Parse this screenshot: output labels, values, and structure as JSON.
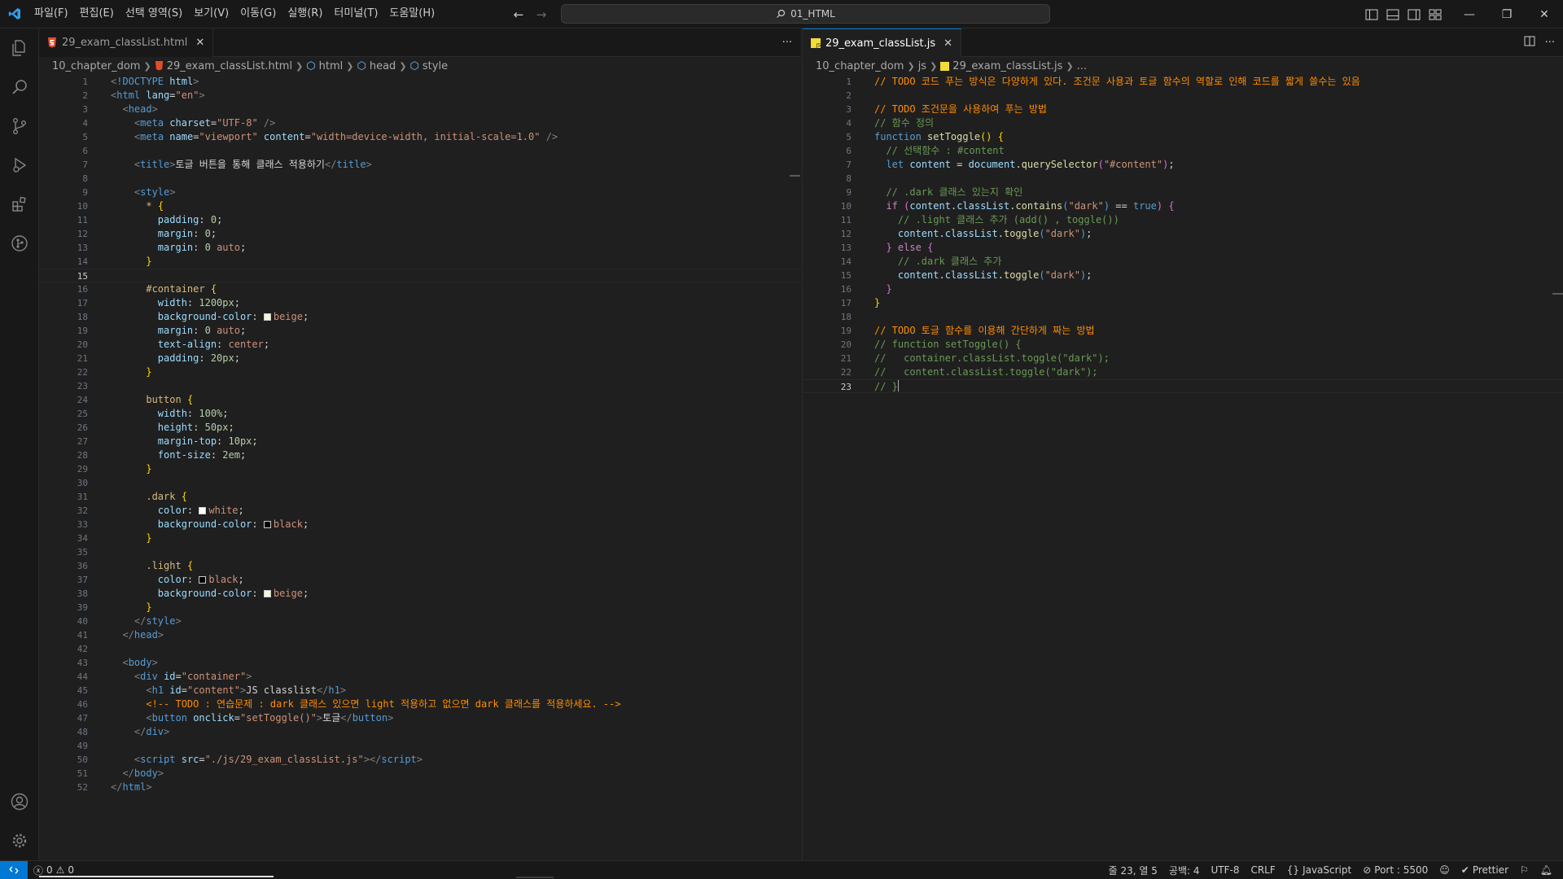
{
  "menu": [
    "파일(F)",
    "편집(E)",
    "선택 영역(S)",
    "보기(V)",
    "이동(G)",
    "실행(R)",
    "터미널(T)",
    "도움말(H)"
  ],
  "command_center": {
    "text": "01_HTML"
  },
  "left": {
    "tab": "29_exam_classList.html",
    "breadcrumb": [
      "10_chapter_dom",
      "29_exam_classList.html",
      "html",
      "head",
      "style"
    ]
  },
  "right": {
    "tab": "29_exam_classList.js",
    "breadcrumb": [
      "10_chapter_dom",
      "js",
      "29_exam_classList.js",
      "..."
    ]
  },
  "status": {
    "problems": "0",
    "warnings": "0",
    "position": "줄 23, 열 5",
    "spaces": "공백: 4",
    "encoding": "UTF-8",
    "eol": "CRLF",
    "language": "JavaScript",
    "port": "Port : 5500",
    "prettier": "Prettier"
  },
  "html_code": [
    [
      [
        "tok-bracket",
        "<"
      ],
      [
        "tok-tag",
        "!DOCTYPE"
      ],
      [
        "tok-text",
        " "
      ],
      [
        "tok-attr",
        "html"
      ],
      [
        "tok-bracket",
        ">"
      ]
    ],
    [
      [
        "tok-bracket",
        "<"
      ],
      [
        "tok-tag",
        "html"
      ],
      [
        "tok-text",
        " "
      ],
      [
        "tok-attr",
        "lang"
      ],
      [
        "tok-text",
        "="
      ],
      [
        "tok-str",
        "\"en\""
      ],
      [
        "tok-bracket",
        ">"
      ]
    ],
    [
      [
        "tok-text",
        "  "
      ],
      [
        "tok-bracket",
        "<"
      ],
      [
        "tok-tag",
        "head"
      ],
      [
        "tok-bracket",
        ">"
      ]
    ],
    [
      [
        "tok-text",
        "    "
      ],
      [
        "tok-bracket",
        "<"
      ],
      [
        "tok-tag",
        "meta"
      ],
      [
        "tok-text",
        " "
      ],
      [
        "tok-attr",
        "charset"
      ],
      [
        "tok-text",
        "="
      ],
      [
        "tok-str",
        "\"UTF-8\""
      ],
      [
        "tok-text",
        " "
      ],
      [
        "tok-bracket",
        "/>"
      ]
    ],
    [
      [
        "tok-text",
        "    "
      ],
      [
        "tok-bracket",
        "<"
      ],
      [
        "tok-tag",
        "meta"
      ],
      [
        "tok-text",
        " "
      ],
      [
        "tok-attr",
        "name"
      ],
      [
        "tok-text",
        "="
      ],
      [
        "tok-str",
        "\"viewport\""
      ],
      [
        "tok-text",
        " "
      ],
      [
        "tok-attr",
        "content"
      ],
      [
        "tok-text",
        "="
      ],
      [
        "tok-str",
        "\"width=device-width, initial-scale=1.0\""
      ],
      [
        "tok-text",
        " "
      ],
      [
        "tok-bracket",
        "/>"
      ]
    ],
    [],
    [
      [
        "tok-text",
        "    "
      ],
      [
        "tok-bracket",
        "<"
      ],
      [
        "tok-tag",
        "title"
      ],
      [
        "tok-bracket",
        ">"
      ],
      [
        "tok-text",
        "토글 버튼을 통해 클래스 적용하기"
      ],
      [
        "tok-bracket",
        "</"
      ],
      [
        "tok-tag",
        "title"
      ],
      [
        "tok-bracket",
        ">"
      ]
    ],
    [],
    [
      [
        "tok-text",
        "    "
      ],
      [
        "tok-bracket",
        "<"
      ],
      [
        "tok-tag",
        "style"
      ],
      [
        "tok-bracket",
        ">"
      ]
    ],
    [
      [
        "tok-text",
        "      "
      ],
      [
        "tok-sel",
        "*"
      ],
      [
        "tok-text",
        " "
      ],
      [
        "tok-brace",
        "{"
      ]
    ],
    [
      [
        "tok-text",
        "        "
      ],
      [
        "tok-prop",
        "padding"
      ],
      [
        "tok-text",
        ": "
      ],
      [
        "tok-num",
        "0"
      ],
      [
        "tok-text",
        ";"
      ]
    ],
    [
      [
        "tok-text",
        "        "
      ],
      [
        "tok-prop",
        "margin"
      ],
      [
        "tok-text",
        ": "
      ],
      [
        "tok-num",
        "0"
      ],
      [
        "tok-text",
        ";"
      ]
    ],
    [
      [
        "tok-text",
        "        "
      ],
      [
        "tok-prop",
        "margin"
      ],
      [
        "tok-text",
        ": "
      ],
      [
        "tok-num",
        "0"
      ],
      [
        "tok-text",
        " "
      ],
      [
        "tok-str",
        "auto"
      ],
      [
        "tok-text",
        ";"
      ]
    ],
    [
      [
        "tok-text",
        "      "
      ],
      [
        "tok-brace",
        "}"
      ]
    ],
    [],
    [
      [
        "tok-text",
        "      "
      ],
      [
        "tok-sel",
        "#container"
      ],
      [
        "tok-text",
        " "
      ],
      [
        "tok-brace",
        "{"
      ]
    ],
    [
      [
        "tok-text",
        "        "
      ],
      [
        "tok-prop",
        "width"
      ],
      [
        "tok-text",
        ": "
      ],
      [
        "tok-num",
        "1200px"
      ],
      [
        "tok-text",
        ";"
      ]
    ],
    [
      [
        "tok-text",
        "        "
      ],
      [
        "tok-prop",
        "background-color"
      ],
      [
        "tok-text",
        ": "
      ],
      [
        "swatch",
        "#f5f5dc"
      ],
      [
        "tok-str",
        "beige"
      ],
      [
        "tok-text",
        ";"
      ]
    ],
    [
      [
        "tok-text",
        "        "
      ],
      [
        "tok-prop",
        "margin"
      ],
      [
        "tok-text",
        ": "
      ],
      [
        "tok-num",
        "0"
      ],
      [
        "tok-text",
        " "
      ],
      [
        "tok-str",
        "auto"
      ],
      [
        "tok-text",
        ";"
      ]
    ],
    [
      [
        "tok-text",
        "        "
      ],
      [
        "tok-prop",
        "text-align"
      ],
      [
        "tok-text",
        ": "
      ],
      [
        "tok-str",
        "center"
      ],
      [
        "tok-text",
        ";"
      ]
    ],
    [
      [
        "tok-text",
        "        "
      ],
      [
        "tok-prop",
        "padding"
      ],
      [
        "tok-text",
        ": "
      ],
      [
        "tok-num",
        "20px"
      ],
      [
        "tok-text",
        ";"
      ]
    ],
    [
      [
        "tok-text",
        "      "
      ],
      [
        "tok-brace",
        "}"
      ]
    ],
    [],
    [
      [
        "tok-text",
        "      "
      ],
      [
        "tok-sel",
        "button"
      ],
      [
        "tok-text",
        " "
      ],
      [
        "tok-brace",
        "{"
      ]
    ],
    [
      [
        "tok-text",
        "        "
      ],
      [
        "tok-prop",
        "width"
      ],
      [
        "tok-text",
        ": "
      ],
      [
        "tok-num",
        "100%"
      ],
      [
        "tok-text",
        ";"
      ]
    ],
    [
      [
        "tok-text",
        "        "
      ],
      [
        "tok-prop",
        "height"
      ],
      [
        "tok-text",
        ": "
      ],
      [
        "tok-num",
        "50px"
      ],
      [
        "tok-text",
        ";"
      ]
    ],
    [
      [
        "tok-text",
        "        "
      ],
      [
        "tok-prop",
        "margin-top"
      ],
      [
        "tok-text",
        ": "
      ],
      [
        "tok-num",
        "10px"
      ],
      [
        "tok-text",
        ";"
      ]
    ],
    [
      [
        "tok-text",
        "        "
      ],
      [
        "tok-prop",
        "font-size"
      ],
      [
        "tok-text",
        ": "
      ],
      [
        "tok-num",
        "2em"
      ],
      [
        "tok-text",
        ";"
      ]
    ],
    [
      [
        "tok-text",
        "      "
      ],
      [
        "tok-brace",
        "}"
      ]
    ],
    [],
    [
      [
        "tok-text",
        "      "
      ],
      [
        "tok-sel",
        ".dark"
      ],
      [
        "tok-text",
        " "
      ],
      [
        "tok-brace",
        "{"
      ]
    ],
    [
      [
        "tok-text",
        "        "
      ],
      [
        "tok-prop",
        "color"
      ],
      [
        "tok-text",
        ": "
      ],
      [
        "swatch",
        "#ffffff"
      ],
      [
        "tok-str",
        "white"
      ],
      [
        "tok-text",
        ";"
      ]
    ],
    [
      [
        "tok-text",
        "        "
      ],
      [
        "tok-prop",
        "background-color"
      ],
      [
        "tok-text",
        ": "
      ],
      [
        "swatch",
        "#000000"
      ],
      [
        "tok-str",
        "black"
      ],
      [
        "tok-text",
        ";"
      ]
    ],
    [
      [
        "tok-text",
        "      "
      ],
      [
        "tok-brace",
        "}"
      ]
    ],
    [],
    [
      [
        "tok-text",
        "      "
      ],
      [
        "tok-sel",
        ".light"
      ],
      [
        "tok-text",
        " "
      ],
      [
        "tok-brace",
        "{"
      ]
    ],
    [
      [
        "tok-text",
        "        "
      ],
      [
        "tok-prop",
        "color"
      ],
      [
        "tok-text",
        ": "
      ],
      [
        "swatch",
        "#000000"
      ],
      [
        "tok-str",
        "black"
      ],
      [
        "tok-text",
        ";"
      ]
    ],
    [
      [
        "tok-text",
        "        "
      ],
      [
        "tok-prop",
        "background-color"
      ],
      [
        "tok-text",
        ": "
      ],
      [
        "swatch",
        "#f5f5dc"
      ],
      [
        "tok-str",
        "beige"
      ],
      [
        "tok-text",
        ";"
      ]
    ],
    [
      [
        "tok-text",
        "      "
      ],
      [
        "tok-brace",
        "}"
      ]
    ],
    [
      [
        "tok-text",
        "    "
      ],
      [
        "tok-bracket",
        "</"
      ],
      [
        "tok-tag",
        "style"
      ],
      [
        "tok-bracket",
        ">"
      ]
    ],
    [
      [
        "tok-text",
        "  "
      ],
      [
        "tok-bracket",
        "</"
      ],
      [
        "tok-tag",
        "head"
      ],
      [
        "tok-bracket",
        ">"
      ]
    ],
    [],
    [
      [
        "tok-text",
        "  "
      ],
      [
        "tok-bracket",
        "<"
      ],
      [
        "tok-tag",
        "body"
      ],
      [
        "tok-bracket",
        ">"
      ]
    ],
    [
      [
        "tok-text",
        "    "
      ],
      [
        "tok-bracket",
        "<"
      ],
      [
        "tok-tag",
        "div"
      ],
      [
        "tok-text",
        " "
      ],
      [
        "tok-attr",
        "id"
      ],
      [
        "tok-text",
        "="
      ],
      [
        "tok-str",
        "\"container\""
      ],
      [
        "tok-bracket",
        ">"
      ]
    ],
    [
      [
        "tok-text",
        "      "
      ],
      [
        "tok-bracket",
        "<"
      ],
      [
        "tok-tag",
        "h1"
      ],
      [
        "tok-text",
        " "
      ],
      [
        "tok-attr",
        "id"
      ],
      [
        "tok-text",
        "="
      ],
      [
        "tok-str",
        "\"content\""
      ],
      [
        "tok-bracket",
        ">"
      ],
      [
        "tok-text",
        "JS classlist"
      ],
      [
        "tok-bracket",
        "</"
      ],
      [
        "tok-tag",
        "h1"
      ],
      [
        "tok-bracket",
        ">"
      ]
    ],
    [
      [
        "tok-text",
        "      "
      ],
      [
        "tok-todo",
        "<!-- TODO : 연습문제 : dark 클래스 있으면 light 적용하고 없으면 dark 클래스를 적용하세요. -->"
      ]
    ],
    [
      [
        "tok-text",
        "      "
      ],
      [
        "tok-bracket",
        "<"
      ],
      [
        "tok-tag",
        "button"
      ],
      [
        "tok-text",
        " "
      ],
      [
        "tok-attr",
        "onclick"
      ],
      [
        "tok-text",
        "="
      ],
      [
        "tok-str",
        "\"setToggle()\""
      ],
      [
        "tok-bracket",
        ">"
      ],
      [
        "tok-text",
        "토글"
      ],
      [
        "tok-bracket",
        "</"
      ],
      [
        "tok-tag",
        "button"
      ],
      [
        "tok-bracket",
        ">"
      ]
    ],
    [
      [
        "tok-text",
        "    "
      ],
      [
        "tok-bracket",
        "</"
      ],
      [
        "tok-tag",
        "div"
      ],
      [
        "tok-bracket",
        ">"
      ]
    ],
    [],
    [
      [
        "tok-text",
        "    "
      ],
      [
        "tok-bracket",
        "<"
      ],
      [
        "tok-tag",
        "script"
      ],
      [
        "tok-text",
        " "
      ],
      [
        "tok-attr",
        "src"
      ],
      [
        "tok-text",
        "="
      ],
      [
        "tok-str",
        "\"./js/29_exam_classList.js\""
      ],
      [
        "tok-bracket",
        "></"
      ],
      [
        "tok-tag",
        "script"
      ],
      [
        "tok-bracket",
        ">"
      ]
    ],
    [
      [
        "tok-text",
        "  "
      ],
      [
        "tok-bracket",
        "</"
      ],
      [
        "tok-tag",
        "body"
      ],
      [
        "tok-bracket",
        ">"
      ]
    ],
    [
      [
        "tok-bracket",
        "</"
      ],
      [
        "tok-tag",
        "html"
      ],
      [
        "tok-bracket",
        ">"
      ]
    ]
  ],
  "js_code": [
    [
      [
        "tok-todo",
        "// TODO 코드 푸는 방식은 다양하게 있다. 조건문 사용과 토글 함수의 역할로 인해 코드를 짧게 쓸수는 있음"
      ]
    ],
    [],
    [
      [
        "tok-todo",
        "// TODO 조건문을 사용하여 푸는 방법"
      ]
    ],
    [
      [
        "tok-com",
        "// 함수 정의"
      ]
    ],
    [
      [
        "tok-kw",
        "function"
      ],
      [
        "tok-text",
        " "
      ],
      [
        "tok-fn",
        "setToggle"
      ],
      [
        "tok-brace",
        "()"
      ],
      [
        "tok-text",
        " "
      ],
      [
        "tok-brace",
        "{"
      ]
    ],
    [
      [
        "tok-text",
        "  "
      ],
      [
        "tok-com",
        "// 선택함수 : #content"
      ]
    ],
    [
      [
        "tok-text",
        "  "
      ],
      [
        "tok-kw",
        "let"
      ],
      [
        "tok-text",
        " "
      ],
      [
        "tok-var",
        "content"
      ],
      [
        "tok-text",
        " = "
      ],
      [
        "tok-var",
        "document"
      ],
      [
        "tok-text",
        "."
      ],
      [
        "tok-fn",
        "querySelector"
      ],
      [
        "tok-brace2",
        "("
      ],
      [
        "tok-str",
        "\"#content\""
      ],
      [
        "tok-brace2",
        ")"
      ],
      [
        "tok-text",
        ";"
      ]
    ],
    [],
    [
      [
        "tok-text",
        "  "
      ],
      [
        "tok-com",
        "// .dark 클래스 있는지 확인"
      ]
    ],
    [
      [
        "tok-text",
        "  "
      ],
      [
        "tok-ctl",
        "if"
      ],
      [
        "tok-text",
        " "
      ],
      [
        "tok-brace2",
        "("
      ],
      [
        "tok-var",
        "content"
      ],
      [
        "tok-text",
        "."
      ],
      [
        "tok-var",
        "classList"
      ],
      [
        "tok-text",
        "."
      ],
      [
        "tok-fn",
        "contains"
      ],
      [
        "tok-tag",
        "("
      ],
      [
        "tok-str",
        "\"dark\""
      ],
      [
        "tok-tag",
        ")"
      ],
      [
        "tok-text",
        " == "
      ],
      [
        "tok-kw",
        "true"
      ],
      [
        "tok-brace2",
        ")"
      ],
      [
        "tok-text",
        " "
      ],
      [
        "tok-brace2",
        "{"
      ]
    ],
    [
      [
        "tok-text",
        "    "
      ],
      [
        "tok-com",
        "// .light 클래스 추가 (add() , toggle())"
      ]
    ],
    [
      [
        "tok-text",
        "    "
      ],
      [
        "tok-var",
        "content"
      ],
      [
        "tok-text",
        "."
      ],
      [
        "tok-var",
        "classList"
      ],
      [
        "tok-text",
        "."
      ],
      [
        "tok-fn",
        "toggle"
      ],
      [
        "tok-tag",
        "("
      ],
      [
        "tok-str",
        "\"dark\""
      ],
      [
        "tok-tag",
        ")"
      ],
      [
        "tok-text",
        ";"
      ]
    ],
    [
      [
        "tok-text",
        "  "
      ],
      [
        "tok-brace2",
        "}"
      ],
      [
        "tok-text",
        " "
      ],
      [
        "tok-ctl",
        "else"
      ],
      [
        "tok-text",
        " "
      ],
      [
        "tok-brace2",
        "{"
      ]
    ],
    [
      [
        "tok-text",
        "    "
      ],
      [
        "tok-com",
        "// .dark 클래스 추가"
      ]
    ],
    [
      [
        "tok-text",
        "    "
      ],
      [
        "tok-var",
        "content"
      ],
      [
        "tok-text",
        "."
      ],
      [
        "tok-var",
        "classList"
      ],
      [
        "tok-text",
        "."
      ],
      [
        "tok-fn",
        "toggle"
      ],
      [
        "tok-tag",
        "("
      ],
      [
        "tok-str",
        "\"dark\""
      ],
      [
        "tok-tag",
        ")"
      ],
      [
        "tok-text",
        ";"
      ]
    ],
    [
      [
        "tok-text",
        "  "
      ],
      [
        "tok-brace2",
        "}"
      ]
    ],
    [
      [
        "tok-brace",
        "}"
      ]
    ],
    [],
    [
      [
        "tok-todo",
        "// TODO 토글 함수를 이용해 간단하게 짜는 방법"
      ]
    ],
    [
      [
        "tok-com",
        "// function setToggle() {"
      ]
    ],
    [
      [
        "tok-com",
        "//   container.classList.toggle(\"dark\");"
      ]
    ],
    [
      [
        "tok-com",
        "//   content.classList.toggle(\"dark\");"
      ]
    ],
    [
      [
        "tok-com",
        "// }"
      ]
    ]
  ]
}
